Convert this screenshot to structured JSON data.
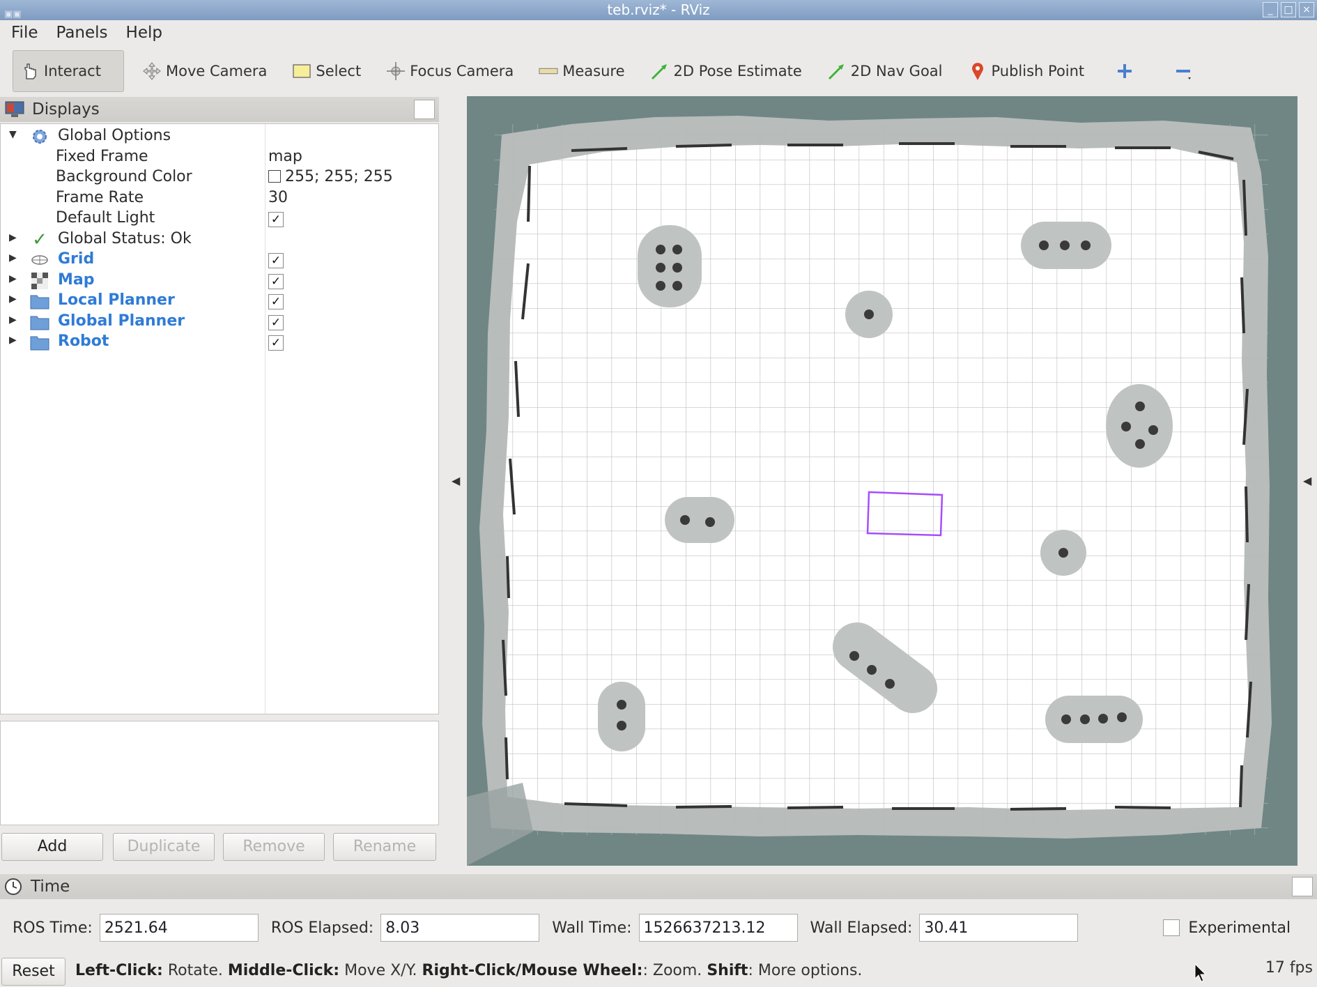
{
  "window": {
    "title": "teb.rviz* - RViz"
  },
  "menu": {
    "file": "File",
    "panels": "Panels",
    "help": "Help"
  },
  "toolbar": {
    "tools": [
      {
        "label": "Interact",
        "icon": "hand-pointer-icon"
      },
      {
        "label": "Move Camera",
        "icon": "move-arrows-icon"
      },
      {
        "label": "Select",
        "icon": "select-rectangle-icon"
      },
      {
        "label": "Focus Camera",
        "icon": "focus-crosshair-icon"
      },
      {
        "label": "Measure",
        "icon": "ruler-icon"
      },
      {
        "label": "2D Pose Estimate",
        "icon": "green-arrow-icon"
      },
      {
        "label": "2D Nav Goal",
        "icon": "green-arrow-icon"
      },
      {
        "label": "Publish Point",
        "icon": "map-pin-icon"
      }
    ],
    "active_tool": "Interact"
  },
  "displays": {
    "title": "Displays",
    "global_options": {
      "label": "Global Options",
      "fixed_frame_label": "Fixed Frame",
      "fixed_frame": "map",
      "background_color_label": "Background Color",
      "background_color": "255; 255; 255",
      "frame_rate_label": "Frame Rate",
      "frame_rate": "30",
      "default_light_label": "Default Light",
      "default_light": true
    },
    "global_status": "Global Status: Ok",
    "items": [
      {
        "label": "Grid",
        "checked": true,
        "icon": "grid-icon"
      },
      {
        "label": "Map",
        "checked": true,
        "icon": "map-icon"
      },
      {
        "label": "Local Planner",
        "checked": true,
        "icon": "folder-icon"
      },
      {
        "label": "Global Planner",
        "checked": true,
        "icon": "folder-icon"
      },
      {
        "label": "Robot",
        "checked": true,
        "icon": "folder-icon"
      }
    ],
    "buttons": {
      "add": "Add",
      "duplicate": "Duplicate",
      "remove": "Remove",
      "rename": "Rename"
    }
  },
  "time": {
    "title": "Time",
    "ros_time_label": "ROS Time:",
    "ros_time": "2521.64",
    "ros_elapsed_label": "ROS Elapsed:",
    "ros_elapsed": "8.03",
    "wall_time_label": "Wall Time:",
    "wall_time": "1526637213.12",
    "wall_elapsed_label": "Wall Elapsed:",
    "wall_elapsed": "30.41",
    "experimental_label": "Experimental"
  },
  "status": {
    "reset": "Reset",
    "left_click_key": "Left-Click:",
    "left_click_text": " Rotate. ",
    "middle_click_key": "Middle-Click:",
    "middle_click_text": " Move X/Y. ",
    "right_click_key": "Right-Click/Mouse Wheel:",
    "right_click_text": ": Zoom. ",
    "shift_key": "Shift",
    "shift_text": ": More options.",
    "fps": "17 fps"
  },
  "colors": {
    "link_blue": "#2f7bd6",
    "map_wall": "#6f8684",
    "robot_footprint": "#a64dff"
  }
}
